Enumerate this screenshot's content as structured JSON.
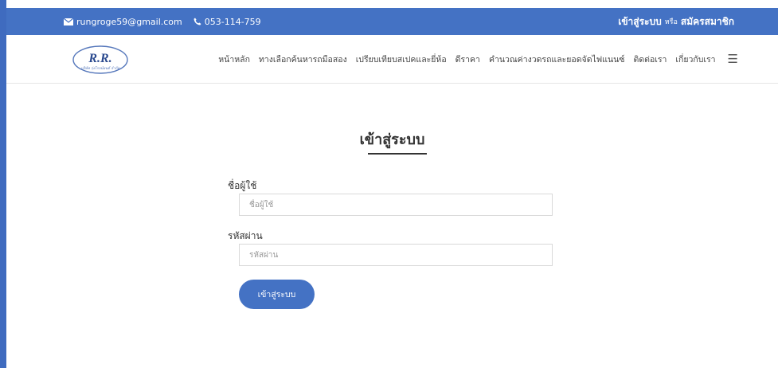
{
  "topbar": {
    "email": "rungroge59@gmail.com",
    "phone": "053-114-759",
    "login_link": "เข้าสู่ระบบ",
    "or_text": "หรือ",
    "register_link": "สมัครสมาชิก"
  },
  "logo": {
    "text": "R.R.",
    "subtext": "บริษัท รุ่งโรจน์ยนต์ จำกัด"
  },
  "nav": {
    "items": [
      "หน้าหลัก",
      "ทางเลือกค้นหารถมือสอง",
      "เปรียบเทียบสเปคและยี่ห้อ",
      "ดีราคา",
      "คำนวณค่างวดรถและยอดจัดไฟแนนซ์",
      "ติดต่อเรา",
      "เกี่ยวกับเรา"
    ]
  },
  "form": {
    "title": "เข้าสู่ระบบ",
    "username_label": "ชื่อผู้ใช้",
    "username_placeholder": "ชื่อผู้ใช้",
    "password_label": "รหัสผ่าน",
    "password_placeholder": "รหัสผ่าน",
    "submit_label": "เข้าสู่ระบบ"
  },
  "colors": {
    "primary": "#4472c4",
    "left_edge": "#3f6bbf"
  }
}
